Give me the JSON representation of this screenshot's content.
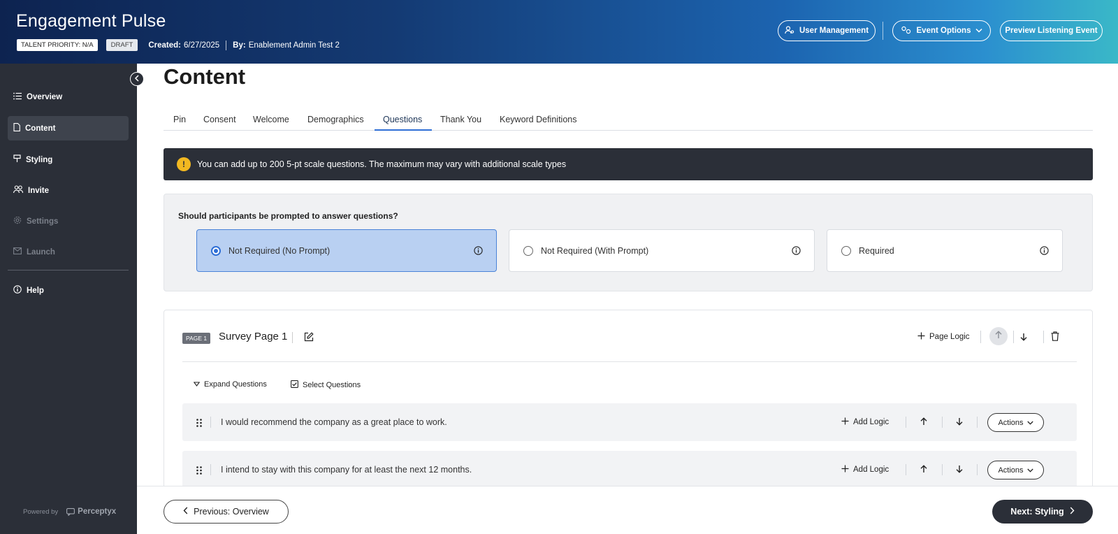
{
  "header": {
    "title": "Engagement Pulse",
    "talent_priority": "TALENT PRIORITY: N/A",
    "status": "DRAFT",
    "created_label": "Created:",
    "created_value": "6/27/2025",
    "by_label": "By:",
    "by_value": "Enablement Admin Test 2",
    "buttons": {
      "user_management": "User Management",
      "event_options": "Event Options",
      "preview": "Preview Listening Event"
    }
  },
  "sidebar": {
    "items": [
      {
        "label": "Overview",
        "icon": "list-icon"
      },
      {
        "label": "Content",
        "icon": "document-icon"
      },
      {
        "label": "Styling",
        "icon": "paint-icon"
      },
      {
        "label": "Invite",
        "icon": "users-icon"
      },
      {
        "label": "Settings",
        "icon": "gear-icon"
      },
      {
        "label": "Launch",
        "icon": "mail-icon"
      },
      {
        "label": "Help",
        "icon": "info-icon"
      }
    ],
    "powered_by": "Powered by",
    "brand": "Perceptyx"
  },
  "main": {
    "page_title": "Content",
    "tabs": [
      "Pin",
      "Consent",
      "Welcome",
      "Demographics",
      "Questions",
      "Thank You",
      "Keyword Definitions"
    ],
    "active_tab": "Questions",
    "banner": "You can add up to 200 5-pt scale questions. The maximum may vary with additional scale types",
    "prompt": {
      "question": "Should participants be prompted to answer questions?",
      "options": [
        "Not Required (No Prompt)",
        "Not Required (With Prompt)",
        "Required"
      ],
      "selected": "Not Required (No Prompt)"
    },
    "survey_page": {
      "badge": "PAGE 1",
      "name": "Survey Page 1",
      "page_logic": "Page Logic",
      "expand_questions": "Expand Questions",
      "select_questions": "Select Questions",
      "questions": [
        {
          "text": "I would recommend the company as a great place to work.",
          "add_logic": "Add Logic",
          "actions": "Actions"
        },
        {
          "text": "I intend to stay with this company for at least the next 12 months.",
          "add_logic": "Add Logic",
          "actions": "Actions"
        }
      ]
    }
  },
  "footer": {
    "previous": "Previous: Overview",
    "next": "Next: Styling"
  },
  "colors": {
    "accent": "#2f6fd6",
    "sidebar_bg": "#2b2f38",
    "selected_option_bg": "#b9d0f2",
    "warning": "#f2b821"
  }
}
